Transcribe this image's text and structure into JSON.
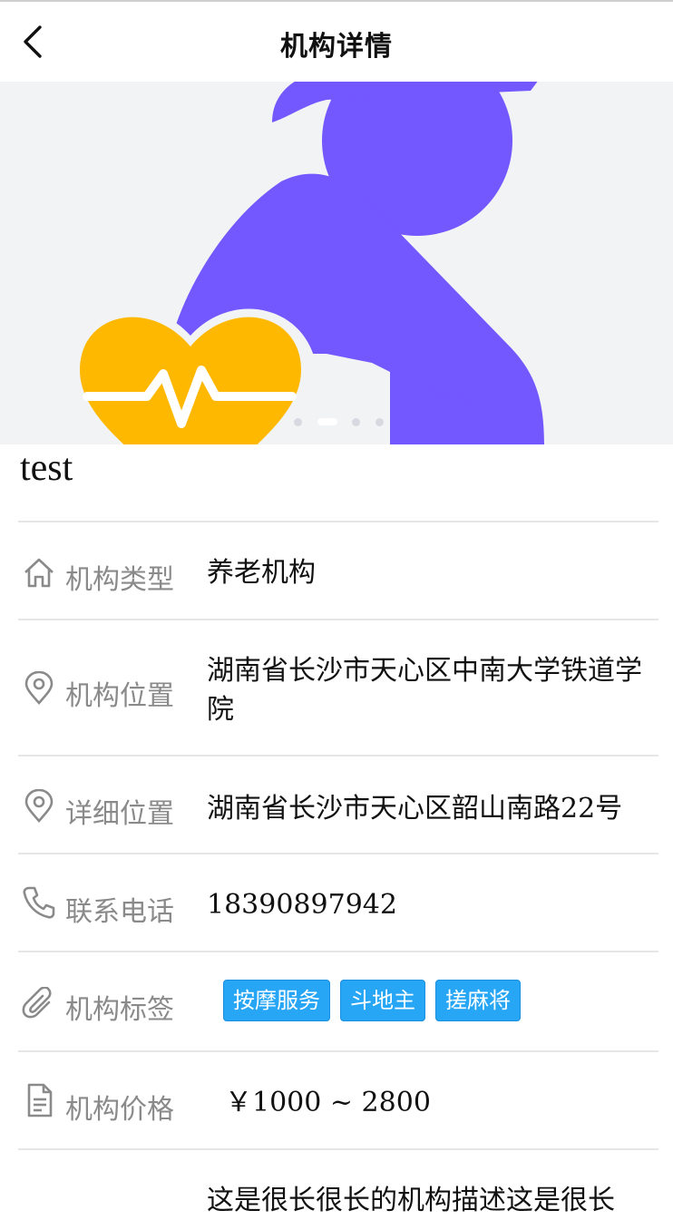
{
  "header": {
    "title": "机构详情",
    "back_icon": "chevron-left-icon"
  },
  "banner": {
    "dots": 4,
    "active_dot": 1,
    "brand_colors": {
      "purple": "#7357ff",
      "yellow": "#ffb800",
      "bg": "#f2f3f5"
    }
  },
  "institution_name": "test",
  "details": {
    "type": {
      "label": "机构类型",
      "value": "养老机构",
      "icon": "home-icon"
    },
    "location": {
      "label": "机构位置",
      "value": "湖南省长沙市天心区中南大学铁道学院",
      "icon": "location-pin-icon"
    },
    "address": {
      "label": "详细位置",
      "value": "湖南省长沙市天心区韶山南路22号",
      "icon": "location-pin-icon"
    },
    "phone": {
      "label": "联系电话",
      "value": "18390897942",
      "icon": "phone-icon"
    },
    "tags": {
      "label": "机构标签",
      "items": [
        "按摩服务",
        "斗地主",
        "搓麻将"
      ],
      "icon": "paperclip-icon"
    },
    "price": {
      "label": "机构价格",
      "value": "￥1000 ~ 2800",
      "icon": "document-icon",
      "color": "#f0a800"
    },
    "description": {
      "value": "这是很长很长的机构描述这是很长"
    }
  }
}
